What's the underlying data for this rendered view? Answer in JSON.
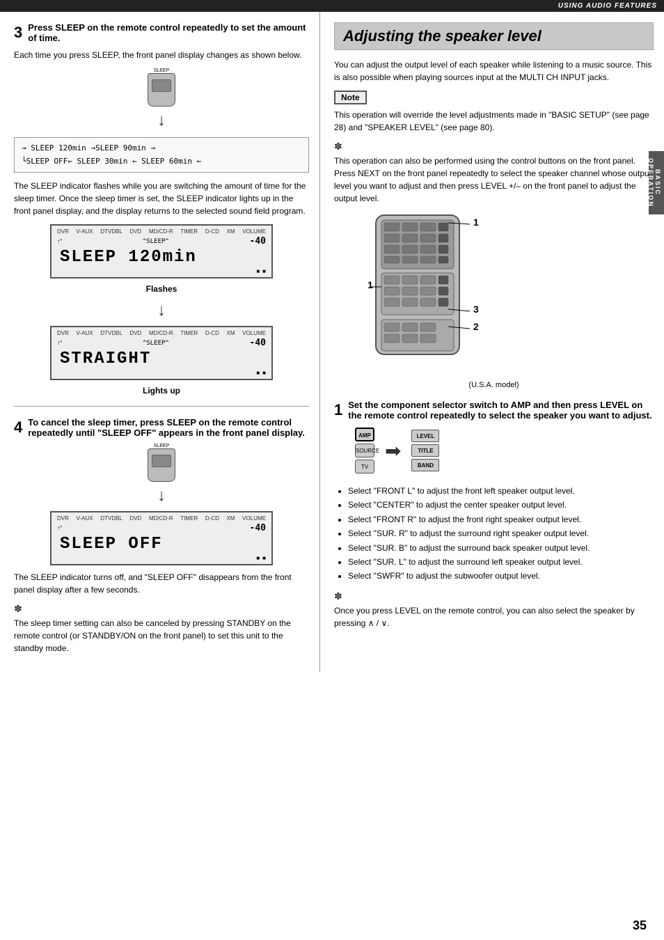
{
  "header": {
    "section": "USING AUDIO FEATURES"
  },
  "left_column": {
    "step3": {
      "number": "3",
      "title": "Press SLEEP on the remote control repeatedly to set the amount of time.",
      "body1": "Each time you press SLEEP, the front panel display changes as shown below.",
      "sleep_diagram": {
        "line1": "→ SLEEP 120min →SLEEP  90min →",
        "line2": "└SLEEP OFF← SLEEP  30min ← SLEEP  60min ←"
      },
      "body2": "The SLEEP indicator flashes while you are switching the amount of time for the sleep timer. Once the sleep timer is set, the SLEEP indicator lights up in the front panel display, and the display returns to the selected sound field program.",
      "display1": {
        "header_items": [
          "DVR",
          "V-AUX",
          "DTVDBL",
          "DVD",
          "MD/CD-R",
          "TIMER",
          "D-CD",
          "XM",
          "VOLUME"
        ],
        "screen": "SLEEP 120min",
        "footer": [
          "m",
          "m"
        ]
      },
      "caption1": "Flashes",
      "display2": {
        "header_items": [
          "DVR",
          "V-AUX",
          "DTVDBL",
          "DVD",
          "MD/CD-R",
          "TIMER",
          "D-CD",
          "XM",
          "VOLUME"
        ],
        "screen": "STRAIGHT",
        "footer": [
          "m",
          "m"
        ]
      },
      "caption2": "Lights up"
    },
    "step4": {
      "number": "4",
      "title": "To cancel the sleep timer, press SLEEP on the remote control repeatedly until \"SLEEP OFF\" appears in the front panel display.",
      "display3": {
        "header_items": [
          "DVR",
          "V-AUX",
          "DTVDBL",
          "DVD",
          "MD/CD-R",
          "TIMER",
          "D-CD",
          "XM",
          "VOLUME"
        ],
        "screen": "SLEEP OFF",
        "footer": [
          "m",
          "m"
        ]
      },
      "body3": "The SLEEP indicator turns off, and \"SLEEP OFF\" disappears from the front panel display after a few seconds.",
      "tip_text": "The sleep timer setting can also be canceled by pressing STANDBY on the remote control (or STANDBY/ON on the front panel) to set this unit to the standby mode."
    }
  },
  "right_column": {
    "title": "Adjusting the speaker level",
    "intro": "You can adjust the output level of each speaker while listening to a music source. This is also possible when playing sources input at the MULTI CH INPUT jacks.",
    "note_label": "Note",
    "note_text": "This operation will override the level adjustments made in \"BASIC SETUP\" (see page 28) and \"SPEAKER LEVEL\" (see page 80).",
    "tip_text": "This operation can also be performed using the control buttons on the front panel. Press NEXT on the front panel repeatedly to select the speaker channel whose output level you want to adjust and then press LEVEL +/– on the front panel to adjust the output level.",
    "usa_model_label": "(U.S.A. model)",
    "labels": {
      "label1": "1",
      "label2": "1",
      "label3": "2",
      "label4": "3"
    },
    "step1": {
      "number": "1",
      "title": "Set the component selector switch to AMP and then press LEVEL on the remote control repeatedly to select the speaker you want to adjust.",
      "amp_label": "AMP",
      "source_label": "SOURCE",
      "tv_label": "TV",
      "level_label": "LEVEL",
      "title_label": "TITLE",
      "band_label": "BAND",
      "bullets": [
        "Select \"FRONT L\" to adjust the front left speaker output level.",
        "Select \"CENTER\" to adjust the center speaker output level.",
        "Select \"FRONT R\" to adjust the front right speaker output level.",
        "Select \"SUR. R\" to adjust the surround right speaker output level.",
        "Select \"SUR. B\" to adjust the surround back speaker output level.",
        "Select \"SUR. L\" to adjust the surround left speaker output level.",
        "Select \"SWFR\" to adjust the subwoofer output level."
      ],
      "tip_text2": "Once you press LEVEL on the remote control, you can also select the speaker by pressing ∧ / ∨."
    }
  },
  "side_tab": {
    "line1": "BASIC",
    "line2": "OPERATION"
  },
  "page_number": "35"
}
